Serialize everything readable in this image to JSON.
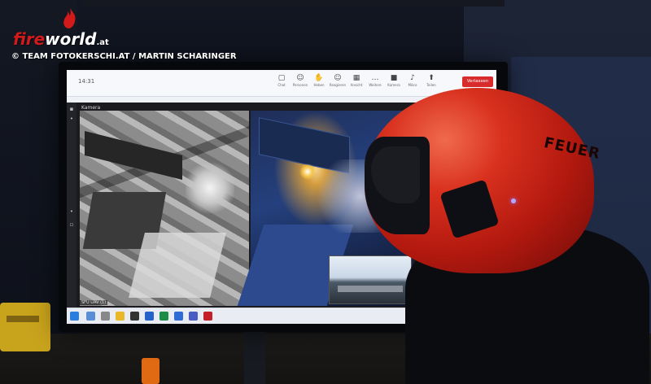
{
  "watermark": {
    "logo_fire": "fire",
    "logo_world": "world",
    "logo_tld": ".at",
    "credit": "© TEAM FOTOKERSCHI.AT / MARTIN SCHARINGER"
  },
  "screen": {
    "titlebar": {
      "time": "14:31",
      "buttons": [
        {
          "icon": "chat-icon",
          "label": "Chat"
        },
        {
          "icon": "people-icon",
          "label": "Personen"
        },
        {
          "icon": "hand-icon",
          "label": "Heben"
        },
        {
          "icon": "react-icon",
          "label": "Reagieren"
        },
        {
          "icon": "view-icon",
          "label": "Ansicht"
        },
        {
          "icon": "more-icon",
          "label": "Weitere"
        },
        {
          "icon": "camera-icon",
          "label": "Kamera"
        },
        {
          "icon": "mic-icon",
          "label": "Mikro"
        },
        {
          "icon": "share-icon",
          "label": "Teilen"
        }
      ],
      "leave_label": "Verlassen"
    },
    "meeting": {
      "panel_title": "Kamera",
      "participant_label": "SFU UAV (1)"
    }
  },
  "helmet": {
    "text": "FEUER",
    "color": "#d8301e"
  }
}
